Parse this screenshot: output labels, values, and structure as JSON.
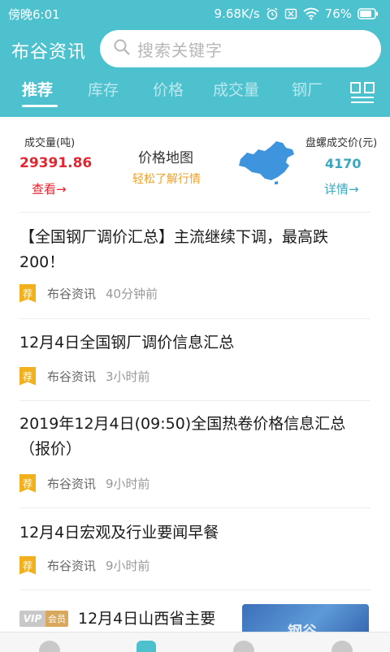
{
  "status_bar": {
    "time": "傍晚6:01",
    "network_speed": "9.68K/s",
    "battery": "76%"
  },
  "header": {
    "app_title": "布谷资讯",
    "search_placeholder": "搜索关键字",
    "tabs": [
      {
        "label": "推荐",
        "active": true
      },
      {
        "label": "库存",
        "active": false
      },
      {
        "label": "价格",
        "active": false
      },
      {
        "label": "成交量",
        "active": false
      },
      {
        "label": "钢厂",
        "active": false
      }
    ]
  },
  "stats": {
    "volume_label": "成交量(吨)",
    "volume_value": "29391.86",
    "volume_link": "查看→",
    "map_title": "价格地图",
    "map_subtitle": "轻松了解行情",
    "price_label": "盘螺成交价(元)",
    "price_value": "4170",
    "price_link": "详情→"
  },
  "news": [
    {
      "title_line1": "【全国钢厂调价汇总】主流继续下调，最高跌",
      "title_line2": "200！",
      "badge": "荐",
      "source": "布谷资讯",
      "time": "40分钟前"
    },
    {
      "title_line1": "12月4日全国钢厂调价信息汇总",
      "badge": "荐",
      "source": "布谷资讯",
      "time": "3小时前"
    },
    {
      "title_line1": "2019年12月4日(09:50)全国热卷价格信息汇总",
      "title_line2": "（报价）",
      "badge": "荐",
      "source": "布谷资讯",
      "time": "9小时前"
    },
    {
      "title_line1": "12月4日宏观及行业要闻早餐",
      "badge": "荐",
      "source": "布谷资讯",
      "time": "9小时前"
    }
  ],
  "vip_item": {
    "badge_vip": "VIP",
    "badge_member": "会员",
    "title": "12月4日山西省主要",
    "thumb_text": "钢谷"
  },
  "colors": {
    "header": "#4ec1cf",
    "red": "#e5252f",
    "teal": "#3aa7c0",
    "badge": "#f2b11c"
  }
}
